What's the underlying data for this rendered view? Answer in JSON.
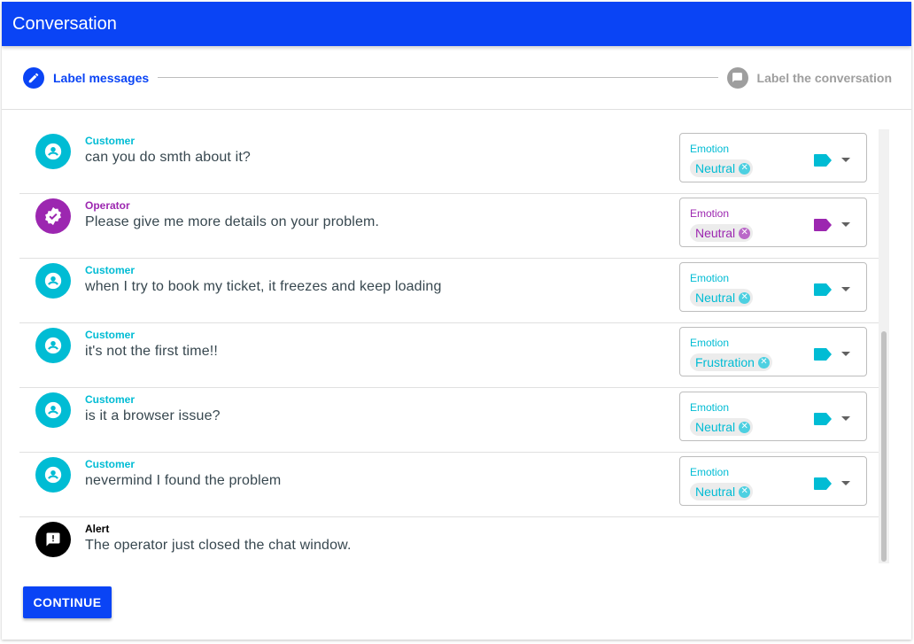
{
  "header": {
    "title": "Conversation"
  },
  "stepper": {
    "steps": [
      {
        "label": "Label messages",
        "state": "active",
        "icon": "pencil-icon"
      },
      {
        "label": "Label the conversation",
        "state": "inactive",
        "icon": "chat-icon"
      }
    ]
  },
  "colors": {
    "accent": "#0a44f5",
    "customer": "#00bcd4",
    "operator": "#9c27b0",
    "alert": "#000000"
  },
  "messages": [
    {
      "role": "Customer",
      "text": "can you do smth about it?",
      "select_label": "Emotion",
      "value": "Neutral"
    },
    {
      "role": "Operator",
      "text": "Please give me more details on your problem.",
      "select_label": "Emotion",
      "value": "Neutral"
    },
    {
      "role": "Customer",
      "text": "when I try to book my ticket, it freezes and keep loading",
      "select_label": "Emotion",
      "value": "Neutral"
    },
    {
      "role": "Customer",
      "text": "it's not the first time!!",
      "select_label": "Emotion",
      "value": "Frustration"
    },
    {
      "role": "Customer",
      "text": "is it a browser issue?",
      "select_label": "Emotion",
      "value": "Neutral"
    },
    {
      "role": "Customer",
      "text": "nevermind I found the problem",
      "select_label": "Emotion",
      "value": "Neutral"
    },
    {
      "role": "Alert",
      "text": "The operator just closed the chat window."
    }
  ],
  "actions": {
    "continue_label": "CONTINUE"
  }
}
